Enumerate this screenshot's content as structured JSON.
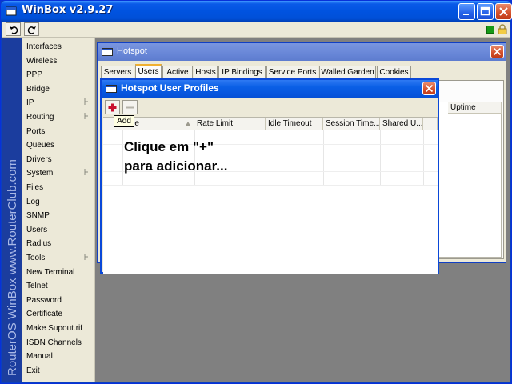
{
  "app": {
    "title": "WinBox v2.9.27",
    "brand_vertical": "RouterOS WinBox   www.RouterClub.com"
  },
  "toolbar": {
    "undo_icon": "undo-icon",
    "redo_icon": "redo-icon"
  },
  "menu": {
    "items": [
      {
        "label": "Interfaces",
        "submenu": false
      },
      {
        "label": "Wireless",
        "submenu": false
      },
      {
        "label": "PPP",
        "submenu": false
      },
      {
        "label": "Bridge",
        "submenu": false
      },
      {
        "label": "IP",
        "submenu": true
      },
      {
        "label": "Routing",
        "submenu": true
      },
      {
        "label": "Ports",
        "submenu": false
      },
      {
        "label": "Queues",
        "submenu": false
      },
      {
        "label": "Drivers",
        "submenu": false
      },
      {
        "label": "System",
        "submenu": true
      },
      {
        "label": "Files",
        "submenu": false
      },
      {
        "label": "Log",
        "submenu": false
      },
      {
        "label": "SNMP",
        "submenu": false
      },
      {
        "label": "Users",
        "submenu": false
      },
      {
        "label": "Radius",
        "submenu": false
      },
      {
        "label": "Tools",
        "submenu": true
      },
      {
        "label": "New Terminal",
        "submenu": false
      },
      {
        "label": "Telnet",
        "submenu": false
      },
      {
        "label": "Password",
        "submenu": false
      },
      {
        "label": "Certificate",
        "submenu": false
      },
      {
        "label": "Make Supout.rif",
        "submenu": false
      },
      {
        "label": "ISDN Channels",
        "submenu": false
      },
      {
        "label": "Manual",
        "submenu": false
      },
      {
        "label": "Exit",
        "submenu": false
      }
    ]
  },
  "hotspot": {
    "title": "Hotspot",
    "tabs": [
      "Servers",
      "Users",
      "Active",
      "Hosts",
      "IP Bindings",
      "Service Ports",
      "Walled Garden",
      "Cookies"
    ],
    "active_tab": "Users",
    "visible_column": "Uptime"
  },
  "profiles": {
    "title": "Hotspot User Profiles",
    "add_tooltip": "Add",
    "columns": [
      "me",
      "Rate Limit",
      "Idle Timeout",
      "Session Time...",
      "Shared U..."
    ],
    "instruction_line1": "Clique em \"+\"",
    "instruction_line2": "para adicionar..."
  },
  "colors": {
    "xp_blue": "#0053e0",
    "workarea_gray": "#808080",
    "add_icon_red": "#c8102e",
    "status_green": "#179a17"
  }
}
